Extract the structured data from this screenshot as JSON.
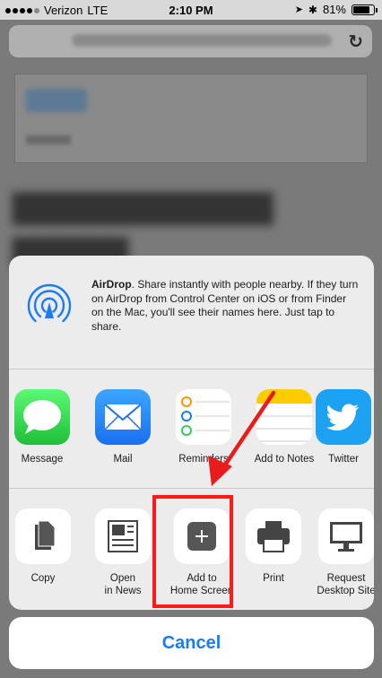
{
  "status_bar": {
    "carrier": "Verizon",
    "network": "LTE",
    "time": "2:10 PM",
    "battery_percent": "81%",
    "battery_level": 0.81
  },
  "airdrop": {
    "title": "AirDrop",
    "description": ". Share instantly with people nearby. If they turn on AirDrop from Control Center on iOS or from Finder on the Mac, you'll see their names here. Just tap to share."
  },
  "apps": [
    {
      "label": "Message",
      "icon": "messages-icon"
    },
    {
      "label": "Mail",
      "icon": "mail-icon"
    },
    {
      "label": "Reminders",
      "icon": "reminders-icon"
    },
    {
      "label": "Add to Notes",
      "icon": "notes-icon"
    },
    {
      "label": "Twitter",
      "icon": "twitter-icon"
    }
  ],
  "actions": [
    {
      "label": "Copy",
      "icon": "copy-icon"
    },
    {
      "label": "Open\nin News",
      "icon": "news-icon"
    },
    {
      "label": "Add to\nHome Screen",
      "icon": "add-icon"
    },
    {
      "label": "Print",
      "icon": "print-icon"
    },
    {
      "label": "Request\nDesktop Site",
      "icon": "desktop-icon"
    }
  ],
  "cancel_label": "Cancel",
  "colors": {
    "accent": "#1a7cf4",
    "highlight": "#ff1a1a",
    "sheet_background": "#ececec"
  }
}
